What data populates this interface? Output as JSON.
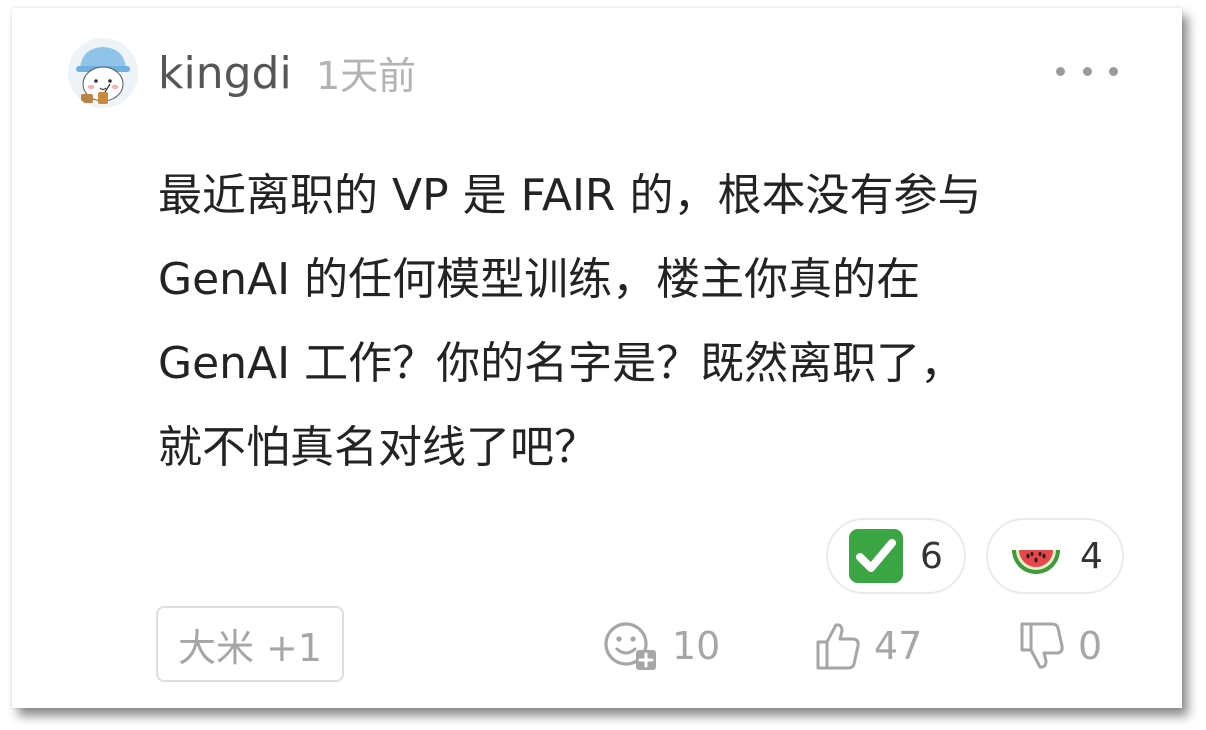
{
  "post": {
    "username": "kingdi",
    "timestamp": "1天前",
    "avatar_icon": "bear-with-blue-hat-avatar",
    "more_icon": "more-dots-icon",
    "body_lines": [
      "最近离职的 VP 是 FAIR 的，根本没有参与",
      "GenAI 的任何模型训练，楼主你真的在",
      "GenAI 工作？你的名字是？既然离职了，",
      "就不怕真名对线了吧？"
    ]
  },
  "reactions": [
    {
      "icon": "check-mark-button-emoji",
      "count": "6"
    },
    {
      "icon": "watermelon-emoji",
      "count": "4"
    }
  ],
  "footer": {
    "tag_label": "大米 +1",
    "comment_count": "10",
    "like_count": "47",
    "dislike_count": "0",
    "comment_icon": "comment-face-plus-icon",
    "like_icon": "thumbs-up-icon",
    "dislike_icon": "thumbs-down-icon"
  },
  "colors": {
    "check_green": "#3ba544",
    "melon_red": "#e8464a",
    "melon_rind": "#3f9a3a",
    "muted_text": "#a6a6a6"
  }
}
